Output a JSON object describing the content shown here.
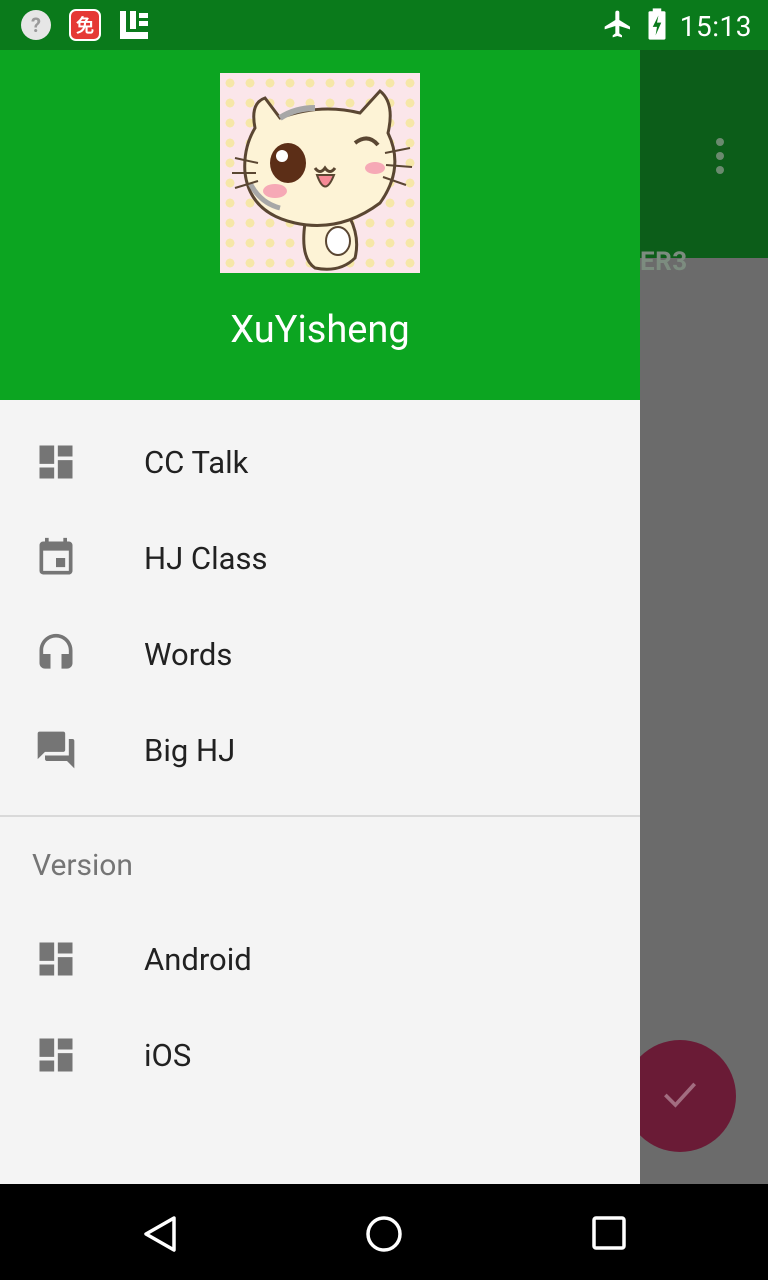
{
  "status_bar": {
    "time": "15:13",
    "left_icons": [
      "help-icon",
      "app-notification-icon",
      "launcher-notification-icon"
    ],
    "app_badge_text": "免",
    "help_text": "?",
    "right_icons": [
      "airplane-mode-icon",
      "battery-charging-icon"
    ]
  },
  "background_app": {
    "tab_label": "ER3",
    "overflow_menu_icon": "more-vert-icon",
    "fab_icon": "check-icon"
  },
  "drawer": {
    "header": {
      "username": "XuYisheng",
      "avatar": "cat-avatar-image"
    },
    "items": [
      {
        "label": "CC Talk",
        "icon": "dashboard-icon"
      },
      {
        "label": "HJ Class",
        "icon": "calendar-event-icon"
      },
      {
        "label": "Words",
        "icon": "headset-icon"
      },
      {
        "label": "Big HJ",
        "icon": "forum-icon"
      }
    ],
    "section": {
      "title": "Version",
      "items": [
        {
          "label": "Android",
          "icon": "dashboard-icon"
        },
        {
          "label": "iOS",
          "icon": "dashboard-icon"
        }
      ]
    }
  },
  "nav_bar": {
    "buttons": [
      "back-icon",
      "home-icon",
      "recents-icon"
    ]
  },
  "colors": {
    "primary": "#0ca521",
    "primary_dark": "#0a7a1b",
    "accent": "#e91e63",
    "drawer_background": "#f4f4f4",
    "scrim": "#6b6b6b"
  }
}
